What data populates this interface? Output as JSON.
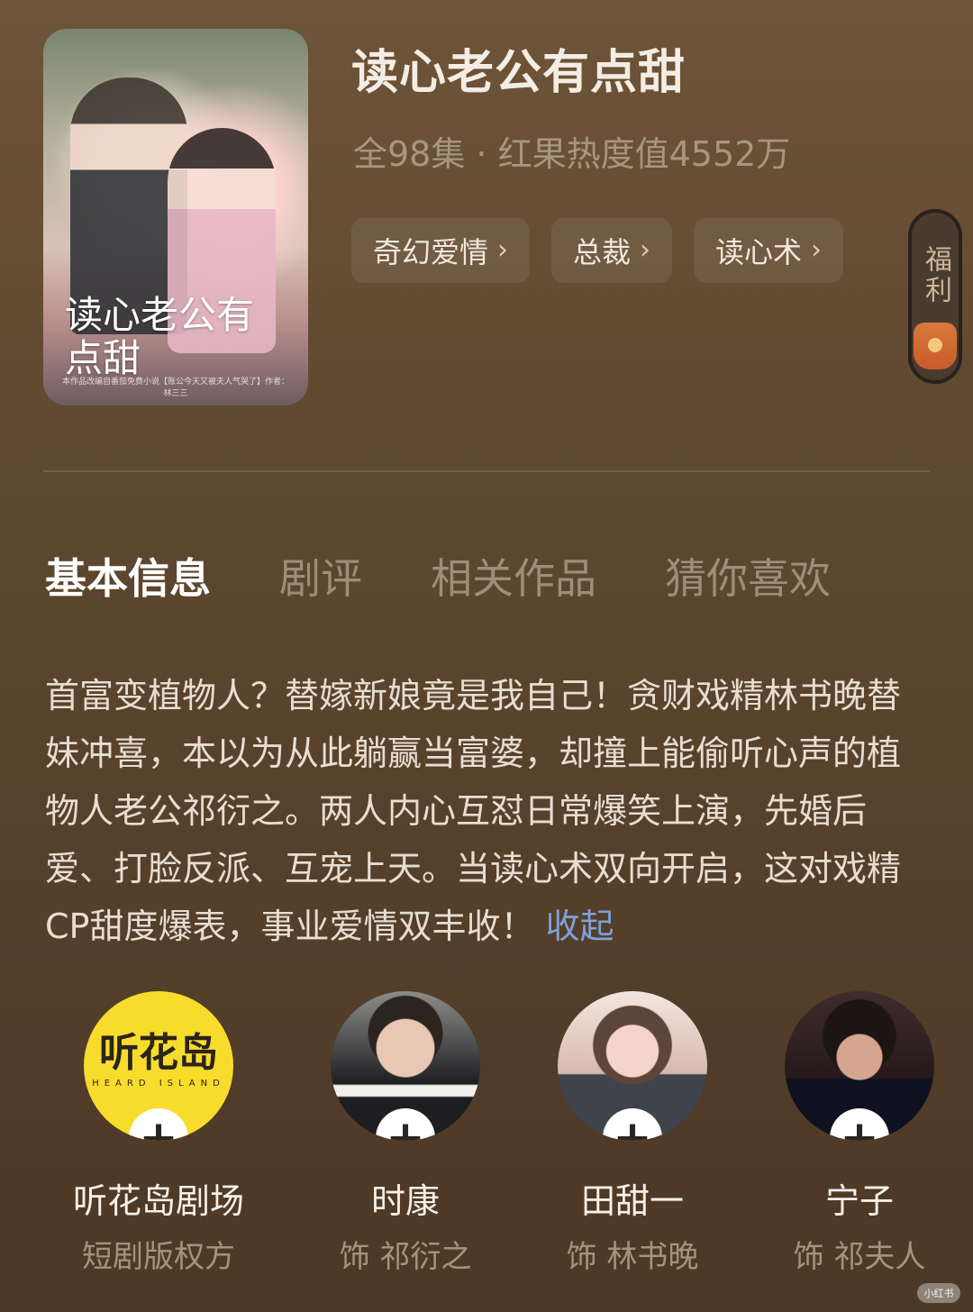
{
  "poster": {
    "title_art": "读心老公有点甜",
    "fine_print": "本作品改编自番茄免费小说【账公今天又被夫人气哭了】作者：林三三"
  },
  "header": {
    "title": "读心老公有点甜",
    "meta": "全98集 · 红果热度值4552万"
  },
  "tags": [
    {
      "label": "奇幻爱情"
    },
    {
      "label": "总裁"
    },
    {
      "label": "读心术"
    }
  ],
  "welfare": {
    "label": "福利"
  },
  "tabs": [
    {
      "label": "基本信息"
    },
    {
      "label": "剧评"
    },
    {
      "label": "相关作品"
    },
    {
      "label": "猜你喜欢"
    }
  ],
  "description": {
    "text": "首富变植物人？替嫁新娘竟是我自己！贪财戏精林书晚替妹冲喜，本以为从此躺赢当富婆，却撞上能偷听心声的植物人老公祁衍之。两人内心互怼日常爆笑上演，先婚后爱、打脸反派、互宠上天。当读心术双向开启，这对戏精CP甜度爆表，事业爱情双丰收！",
    "collapse_label": "收起"
  },
  "cast": [
    {
      "name": "听花岛剧场",
      "role": "短剧版权方",
      "avatar_text": "听花岛",
      "avatar_subtext": "HEARD ISLAND"
    },
    {
      "name": "时康",
      "role": "饰 祁衍之"
    },
    {
      "name": "田甜一",
      "role": "饰 林书晚"
    },
    {
      "name": "宁子",
      "role": "饰 祁夫人"
    }
  ],
  "colors": {
    "background_top": "#6e5438",
    "background_bottom": "#4c3826",
    "accent_link": "#7ea1da",
    "logo_yellow": "#f8dc2c"
  },
  "watermark": "小红书"
}
